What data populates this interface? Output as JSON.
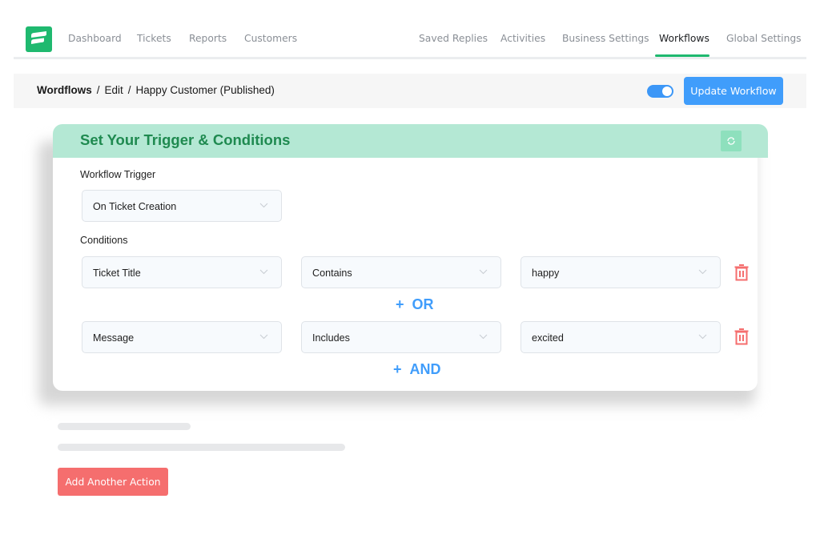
{
  "nav": {
    "logo": "fluent-support-logo",
    "left_items": [
      {
        "label": "Dashboard"
      },
      {
        "label": "Tickets"
      },
      {
        "label": "Reports"
      },
      {
        "label": "Customers"
      }
    ],
    "right_items": [
      {
        "label": "Saved Replies"
      },
      {
        "label": "Activities"
      },
      {
        "label": "Business Settings"
      },
      {
        "label": "Workflows",
        "active": true
      },
      {
        "label": "Global Settings"
      }
    ]
  },
  "breadcrumb": {
    "root": "Wordflows",
    "separator": "/",
    "edit": "Edit",
    "current": "Happy Customer (Published)"
  },
  "header_actions": {
    "toggle_state": "on",
    "update_label": "Update Workflow"
  },
  "colors": {
    "brand_green": "#1fb96f",
    "accent_blue": "#409dfb",
    "danger_red": "#f56e6e",
    "card_header": "#b4e8d4",
    "title_green": "#1f8a50"
  },
  "card": {
    "title": "Set Your Trigger & Conditions",
    "trigger_label": "Workflow Trigger",
    "trigger_value": "On Ticket Creation",
    "conditions_label": "Conditions",
    "conditions": [
      {
        "field": "Ticket Title",
        "operator": "Contains",
        "value": "happy"
      },
      {
        "field": "Message",
        "operator": "Includes",
        "value": "excited"
      }
    ],
    "or_button": {
      "plus": "+",
      "label": "OR"
    },
    "and_button": {
      "plus": "+",
      "label": "AND"
    }
  },
  "footer": {
    "add_action_label": "Add Another Action"
  }
}
